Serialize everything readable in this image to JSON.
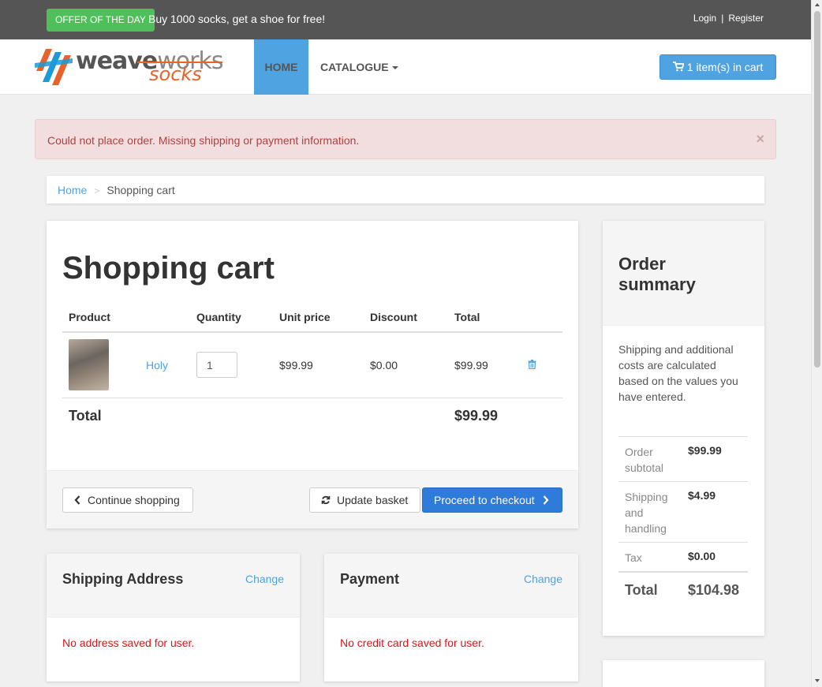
{
  "topbar": {
    "offer_badge": "OFFER OF THE DAY",
    "offer_text": "Buy 1000 socks, get a shoe for free!",
    "login": "Login",
    "separator": "|",
    "register": "Register"
  },
  "logo": {
    "text_weave": "weave",
    "text_works": "works",
    "text_socks": "socks"
  },
  "nav": {
    "home": "HOME",
    "catalogue": "CATALOGUE",
    "cart_button": "1 item(s) in cart"
  },
  "alert": {
    "message": "Could not place order. Missing shipping or payment information.",
    "close": "×"
  },
  "breadcrumb": {
    "home": "Home",
    "separator": ">",
    "current": "Shopping cart"
  },
  "cart": {
    "title": "Shopping cart",
    "columns": [
      "Product",
      "Quantity",
      "Unit price",
      "Discount",
      "Total"
    ],
    "items": [
      {
        "name": "Holy",
        "quantity": "1",
        "unit_price": "$99.99",
        "discount": "$0.00",
        "total": "$99.99"
      }
    ],
    "total_label": "Total",
    "total_value": "$99.99",
    "continue_shopping": "Continue shopping",
    "update_basket": "Update basket",
    "proceed_checkout": "Proceed to checkout"
  },
  "shipping": {
    "title": "Shipping Address",
    "change": "Change",
    "message": "No address saved for user."
  },
  "payment": {
    "title": "Payment",
    "change": "Change",
    "message": "No credit card saved for user."
  },
  "summary": {
    "title": "Order summary",
    "description": "Shipping and additional costs are calculated based on the values you have entered.",
    "rows": [
      {
        "label": "Order subtotal",
        "value": "$99.99"
      },
      {
        "label": "Shipping and handling",
        "value": "$4.99"
      },
      {
        "label": "Tax",
        "value": "$0.00"
      }
    ],
    "total_label": "Total",
    "total_value": "$104.98"
  },
  "colors": {
    "accent": "#4fa3e0",
    "primary_button": "#2e7bd9",
    "offer_green": "#4fbf5b",
    "error_red": "#e0131a",
    "brand_orange": "#e8622c"
  }
}
